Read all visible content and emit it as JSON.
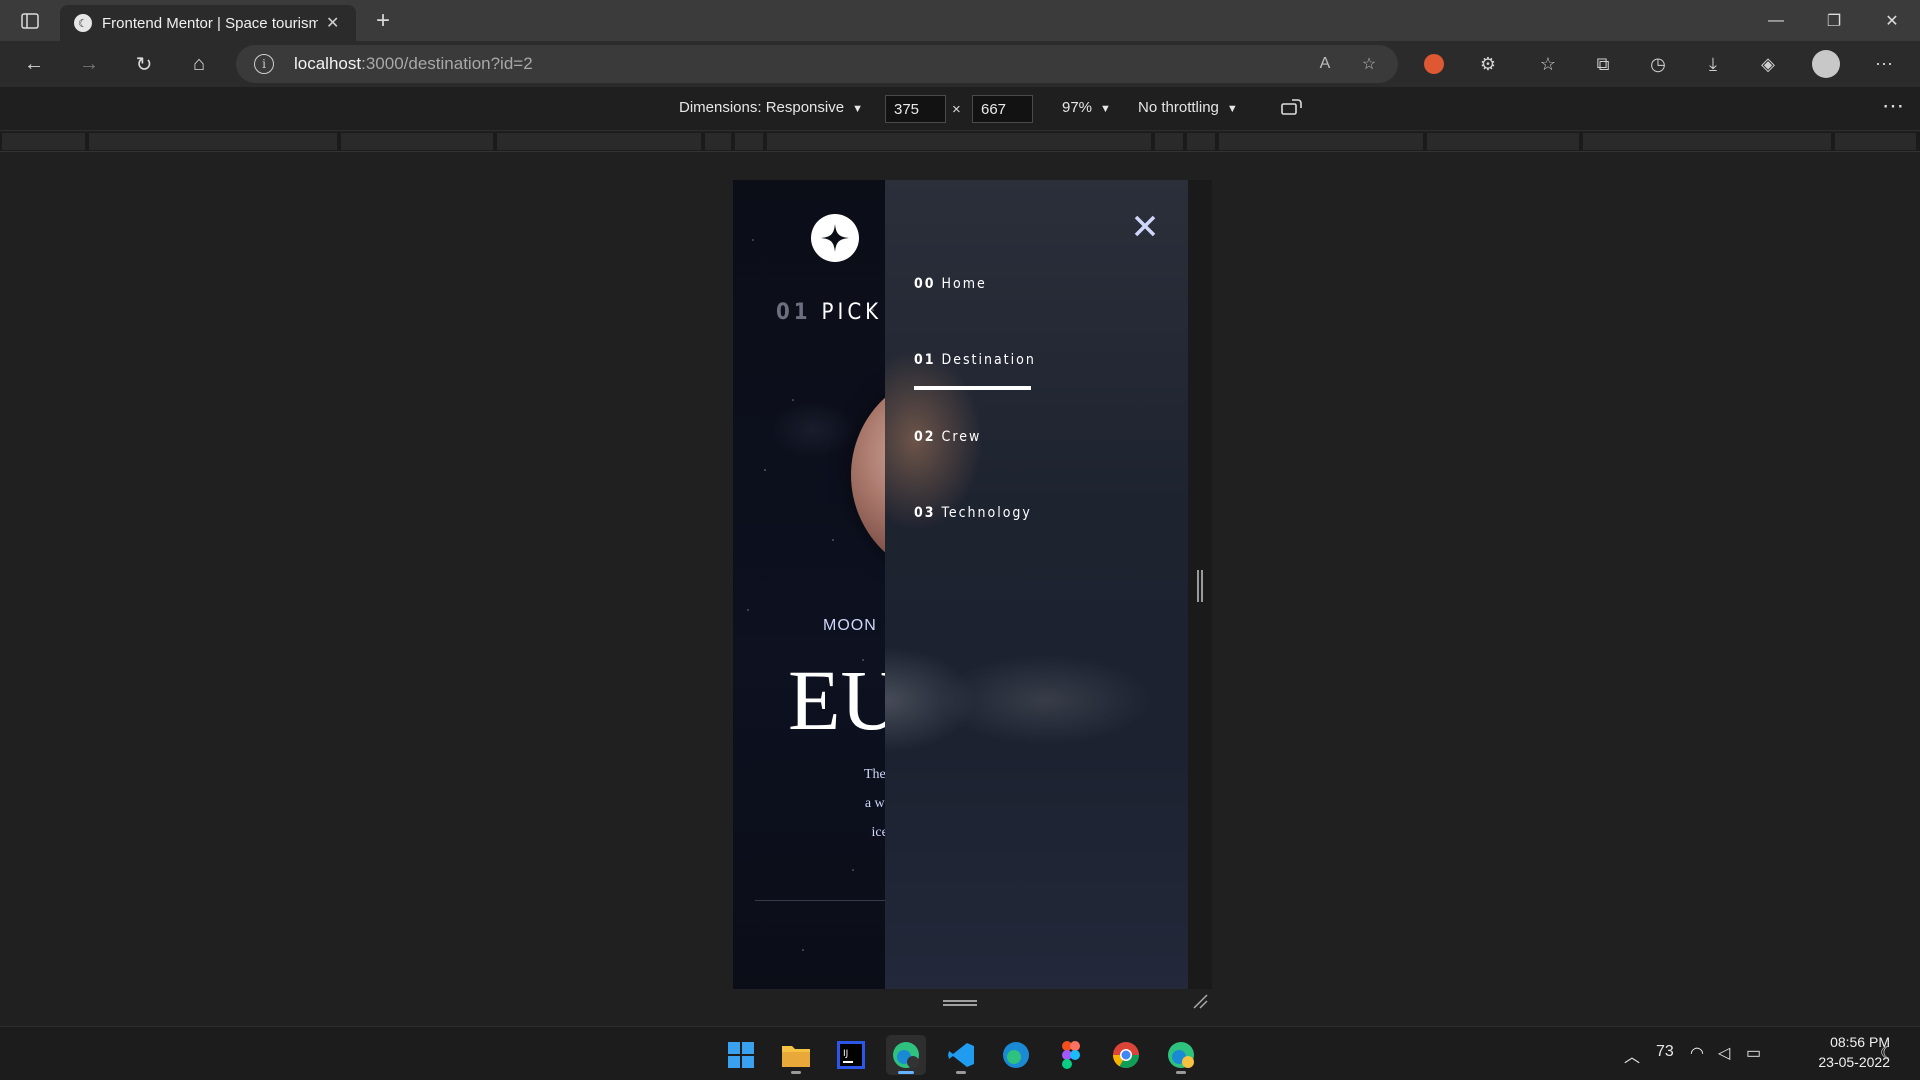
{
  "browser": {
    "tab_title": "Frontend Mentor | Space tourism",
    "url_host": "localhost",
    "url_path": ":3000/destination?id=2"
  },
  "devtools": {
    "dimensions_label": "Dimensions: Responsive",
    "width": "375",
    "height": "667",
    "times": "×",
    "zoom": "97%",
    "throttling": "No throttling"
  },
  "page": {
    "heading_number": "01",
    "heading_text": "PICK",
    "planet_tab": "MOON",
    "planet_name": "EU",
    "description_lines": [
      "The smallest of the fo",
      "a winter lover's drean",
      "ice skating, curling"
    ]
  },
  "nav": {
    "items": [
      {
        "number": "00",
        "label": "Home"
      },
      {
        "number": "01",
        "label": "Destination"
      },
      {
        "number": "02",
        "label": "Crew"
      },
      {
        "number": "03",
        "label": "Technology"
      }
    ],
    "active_index": 1
  },
  "taskbar": {
    "apps": [
      "windows-start",
      "file-explorer",
      "intellij",
      "edge-dev",
      "vscode",
      "edge-beta",
      "figma",
      "chrome",
      "edge-canary"
    ],
    "tray_count": "73",
    "time": "08:56 PM",
    "date": "23-05-2022"
  },
  "colors": {
    "page_bg": "#0b0d17",
    "accent_text": "#d0d6f9"
  }
}
